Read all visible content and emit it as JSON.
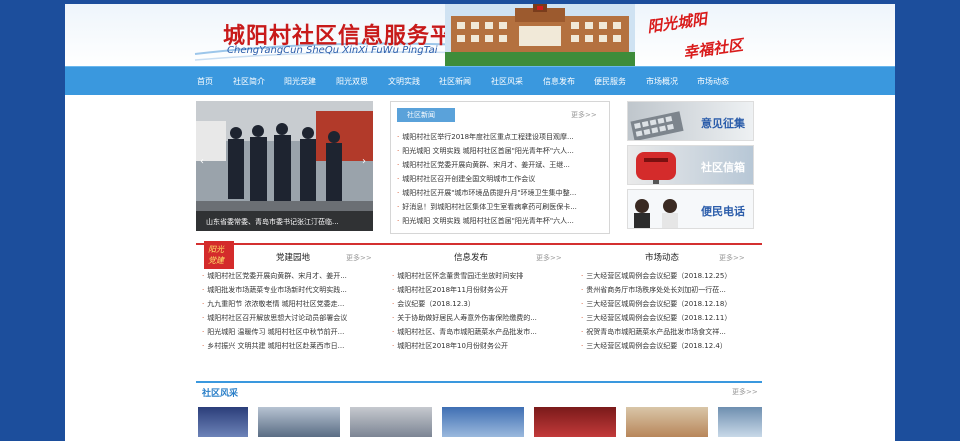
{
  "header": {
    "title": "城阳村社区信息服务平台",
    "pinyin": "ChengYangCun SheQu XinXi FuWu PingTai",
    "slogan_line1": "阳光城阳",
    "slogan_line2": "幸福社区"
  },
  "nav": {
    "items": [
      "首页",
      "社区简介",
      "阳光党建",
      "阳光双思",
      "文明实践",
      "社区新闻",
      "社区风采",
      "信息发布",
      "便民服务",
      "市场概况",
      "市场动态"
    ]
  },
  "slider": {
    "caption": "山东省委常委、青岛市委书记张江汀莅临...",
    "prev_arrow": "‹",
    "next_arrow": "›"
  },
  "news": {
    "tab_label": "社区新闻",
    "more": "更多>>",
    "items": [
      "城阳村社区举行2018年度社区重点工程建设项目观摩...",
      "阳光城阳 文明实践 城阳村社区首届\"阳光青年杯\"六人...",
      "城阳村社区党委开展向黄群、宋月才、姜开斌、王继...",
      "城阳村社区召开创建全国文明城市工作会议",
      "城阳村社区开展\"城市环境品质提升月\"环境卫生集中整...",
      "好消息！到城阳村社区集体卫生室看病拿药可刷医保卡...",
      "阳光城阳 文明实践 城阳村社区首届\"阳光青年杯\"六人..."
    ]
  },
  "side_panels": [
    {
      "label": "意见征集",
      "color": "#2a5caa"
    },
    {
      "label": "社区信箱",
      "color": "#ffffff"
    },
    {
      "label": "便民电话",
      "color": "#2a5caa"
    }
  ],
  "party": {
    "badge": "阳光 党建",
    "title": "党建园地",
    "more": "更多>>",
    "items": [
      "城阳村社区党委开展向黄群、宋月才、姜开...",
      "城阳批发市场蔬菜专业市场新时代文明实践...",
      "九九重阳节 浓浓敬老情 城阳村社区党委走...",
      "城阳村社区召开解放思想大讨论动员部署会议",
      "阳光城阳 温暖传习 城阳村社区中秋节前开...",
      "乡村振兴 文明共建 城阳村社区赴莱西市日..."
    ]
  },
  "info": {
    "title": "信息发布",
    "more": "更多>>",
    "items": [
      "城阳村社区怀念董贵雪园迁坐放时间安排",
      "城阳村社区2018年11月份财务公开",
      "会议纪要（2018.12.3）",
      "关于协助做好居民人寿意外伤害保险缴费的...",
      "城阳村社区、青岛市城阳蔬菜水产品批发市...",
      "城阳村社区2018年10月份财务公开"
    ]
  },
  "market": {
    "title": "市场动态",
    "more": "更多>>",
    "items": [
      "三大经营区城周例会会议纪要（2018.12.25）",
      "贵州省商务厅市场秩序处处长刘加初一行莅...",
      "三大经营区城周例会会议纪要（2018.12.18）",
      "三大经营区城周例会会议纪要（2018.12.11）",
      "祝贺青岛市城阳蔬菜水产品批发市场食文祥...",
      "三大经营区城周例会会议纪要（2018.12.4）"
    ]
  },
  "scenery": {
    "title": "社区风采",
    "more": "更多>>"
  },
  "colors": {
    "background": "#1c4e9c",
    "nav": "#3a98de",
    "accent_red": "#d43030"
  }
}
